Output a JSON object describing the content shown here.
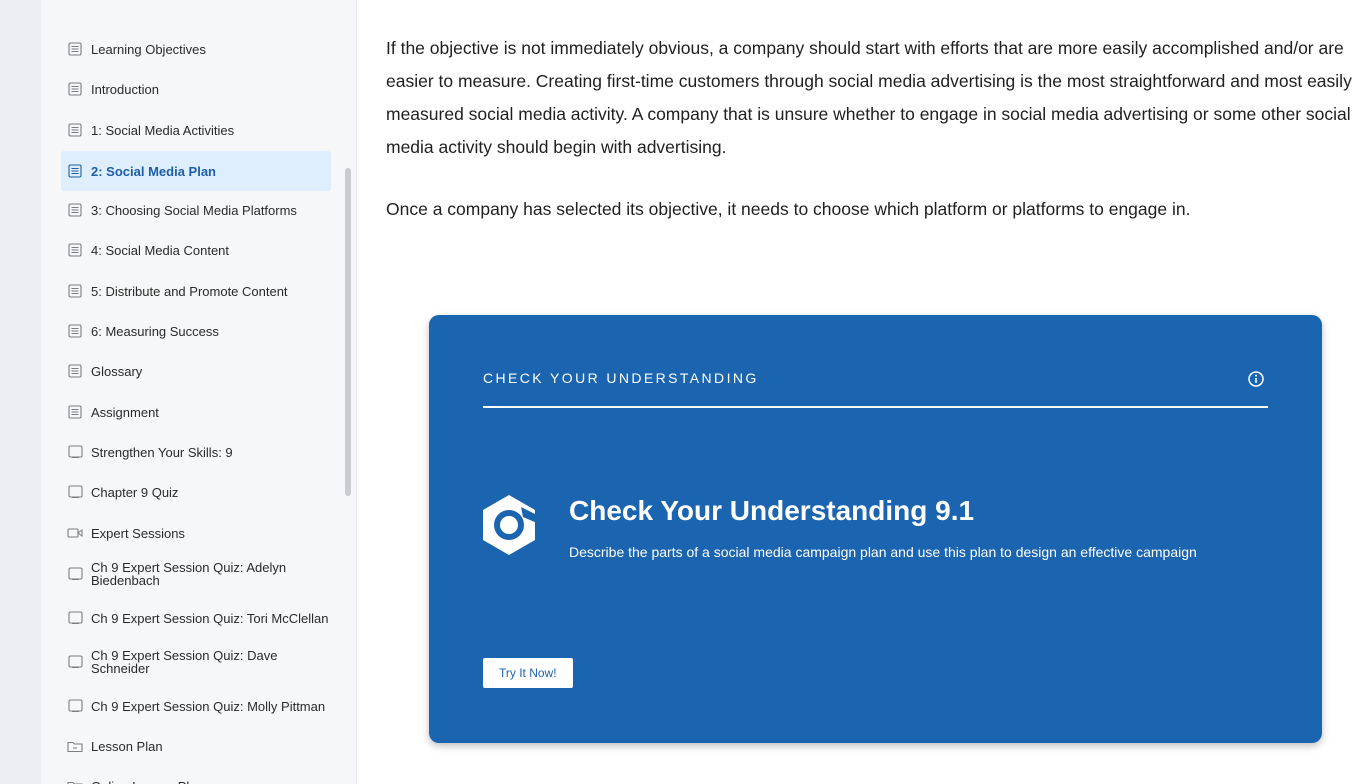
{
  "sidebar": {
    "items": [
      {
        "label": "Learning Objectives",
        "icon": "page-icon",
        "active": false
      },
      {
        "label": "Introduction",
        "icon": "page-icon",
        "active": false
      },
      {
        "label": "1: Social Media Activities",
        "icon": "page-icon",
        "active": false
      },
      {
        "label": "2: Social Media Plan",
        "icon": "page-icon",
        "active": true
      },
      {
        "label": "3: Choosing Social Media Platforms",
        "icon": "page-icon",
        "active": false
      },
      {
        "label": "4: Social Media Content",
        "icon": "page-icon",
        "active": false
      },
      {
        "label": "5: Distribute and Promote Content",
        "icon": "page-icon",
        "active": false
      },
      {
        "label": "6: Measuring Success",
        "icon": "page-icon",
        "active": false
      },
      {
        "label": "Glossary",
        "icon": "page-icon",
        "active": false
      },
      {
        "label": "Assignment",
        "icon": "page-icon",
        "active": false
      },
      {
        "label": "Strengthen Your Skills: 9",
        "icon": "quiz-icon",
        "active": false
      },
      {
        "label": "Chapter 9 Quiz",
        "icon": "quiz-icon",
        "active": false
      },
      {
        "label": "Expert Sessions",
        "icon": "video-icon",
        "active": false
      },
      {
        "label": "Ch 9 Expert Session Quiz: Adelyn Biedenbach",
        "icon": "quiz-icon",
        "active": false
      },
      {
        "label": "Ch 9 Expert Session Quiz: Tori McClellan",
        "icon": "quiz-icon",
        "active": false
      },
      {
        "label": "Ch 9 Expert Session Quiz: Dave Schneider",
        "icon": "quiz-icon",
        "active": false
      },
      {
        "label": "Ch 9 Expert Session Quiz: Molly Pittman",
        "icon": "quiz-icon",
        "active": false
      },
      {
        "label": "Lesson Plan",
        "icon": "folder-icon",
        "active": false
      },
      {
        "label": "Online Lesson Plan",
        "icon": "folder-icon",
        "active": false
      }
    ]
  },
  "content": {
    "paragraphs": [
      "If the objective is not immediately obvious, a company should start with efforts that are more easily accomplished and/or are easier to measure. Creating first-time customers through social media advertising is the most straightforward and most easily measured social media activity. A company that is unsure whether to engage in social media advertising or some other social media activity should begin with advertising.",
      "Once a company has selected its objective, it needs to choose which platform or platforms to engage in."
    ]
  },
  "card": {
    "header": "CHECK YOUR UNDERSTANDING",
    "title": "Check Your Understanding 9.1",
    "description": "Describe the parts of a social media campaign plan and use this plan to design an effective campaign",
    "button_label": "Try It Now!"
  },
  "colors": {
    "accent": "#1b64b0",
    "active_bg": "#dfeefc",
    "active_text": "#1c5fa8",
    "sidebar_bg": "#f6f7f8"
  }
}
